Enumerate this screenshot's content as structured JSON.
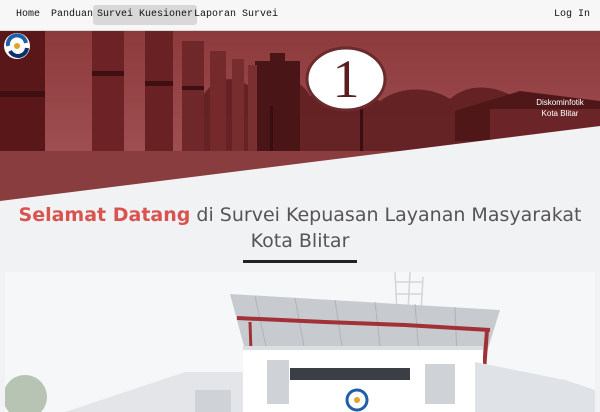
{
  "nav": {
    "home": "Home",
    "panduan": "Panduan",
    "kuesioner": "Survei Kuesioner",
    "laporan": "Laporan Survei",
    "login": "Log In"
  },
  "hero": {
    "number": "1",
    "brand_line1": "Diskominfotik",
    "brand_line2": "Kota Blitar"
  },
  "welcome": {
    "accent": "Selamat Datang",
    "rest": " di Survei Kepuasan Layanan Masyarakat",
    "line2": "Kota Blitar"
  },
  "colors": {
    "accent": "#d9534f",
    "hero_tint": "#7a1f22",
    "navbar_bg": "#f7f7f7",
    "page_bg": "#f1f2f4"
  },
  "icons": {
    "brand_logo": "kominfo-logo-icon"
  }
}
